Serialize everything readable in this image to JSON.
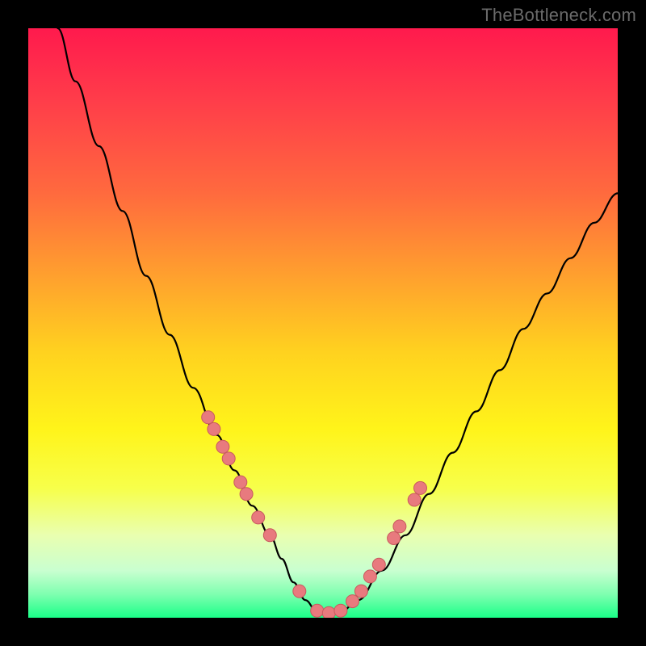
{
  "watermark": {
    "text": "TheBottleneck.com"
  },
  "colors": {
    "frame": "#000000",
    "gradient_top": "#ff1a4d",
    "gradient_bottom": "#1aff88",
    "curve": "#000000",
    "dot_fill": "#e87a7e",
    "dot_stroke": "#c85a5e"
  },
  "chart_data": {
    "type": "line",
    "title": "",
    "xlabel": "",
    "ylabel": "",
    "xlim": [
      0,
      100
    ],
    "ylim": [
      0,
      100
    ],
    "note": "Axes are unlabeled in the source image; x and y are normalized 0–100. y=0 is the bottom (green) edge, y=100 is the top (red) edge.",
    "series": [
      {
        "name": "bottleneck-curve",
        "x": [
          5,
          8,
          12,
          16,
          20,
          24,
          28,
          32,
          35,
          38,
          41,
          43,
          45,
          47,
          49,
          51,
          53,
          56,
          60,
          64,
          68,
          72,
          76,
          80,
          84,
          88,
          92,
          96,
          100
        ],
        "y": [
          100,
          91,
          80,
          69,
          58,
          48,
          39,
          31,
          25,
          19,
          14,
          10,
          6,
          3,
          1,
          0.5,
          1,
          3,
          8,
          14,
          21,
          28,
          35,
          42,
          49,
          55,
          61,
          67,
          72
        ]
      }
    ],
    "points": {
      "name": "highlight-dots",
      "x": [
        30.5,
        31.5,
        33,
        34,
        36,
        37,
        39,
        41,
        46,
        49,
        51,
        53,
        55,
        56.5,
        58,
        59.5,
        62,
        63,
        65.5,
        66.5
      ],
      "y": [
        34,
        32,
        29,
        27,
        23,
        21,
        17,
        14,
        4.5,
        1.2,
        0.8,
        1.2,
        2.8,
        4.5,
        7,
        9,
        13.5,
        15.5,
        20,
        22
      ]
    }
  }
}
